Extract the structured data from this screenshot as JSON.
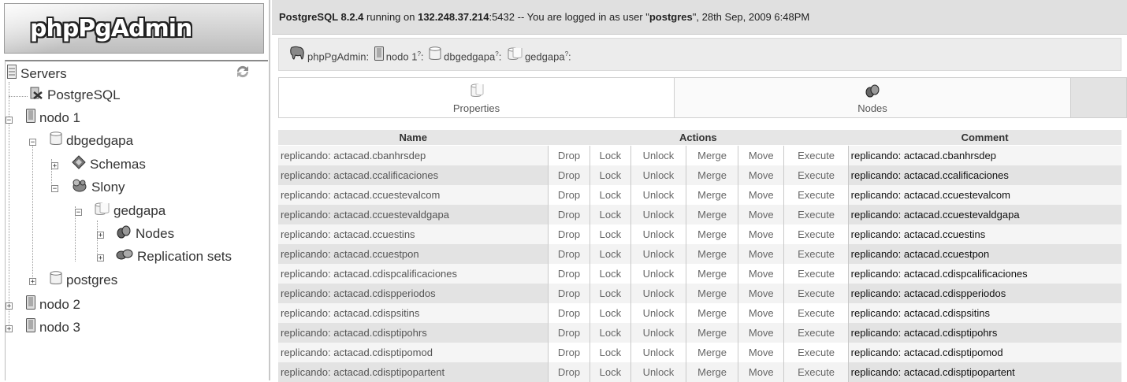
{
  "app": {
    "logo_text": "phpPgAdmin"
  },
  "sidebar": {
    "tree": [
      {
        "label": "Servers",
        "icon": "servers-icon"
      },
      {
        "label": "PostgreSQL",
        "icon": "server-disconnected-icon"
      },
      {
        "label": "nodo 1",
        "icon": "server-icon"
      },
      {
        "label": "dbgedgapa",
        "icon": "database-icon"
      },
      {
        "label": "Schemas",
        "icon": "schemas-icon"
      },
      {
        "label": "Slony",
        "icon": "slony-icon"
      },
      {
        "label": "gedgapa",
        "icon": "cluster-icon"
      },
      {
        "label": "Nodes",
        "icon": "nodes-icon"
      },
      {
        "label": "Replication sets",
        "icon": "replication-sets-icon"
      },
      {
        "label": "postgres",
        "icon": "database-icon"
      },
      {
        "label": "nodo 2",
        "icon": "server-icon"
      },
      {
        "label": "nodo 3",
        "icon": "server-icon"
      }
    ]
  },
  "topbar": {
    "product": "PostgreSQL 8.2.4",
    "running_on": " running on ",
    "host": "132.248.37.214",
    "port": ":5432",
    "logged_text": " -- You are logged in as user \"",
    "user": "postgres",
    "date_text": "\", 28th Sep, 2009 6:48PM"
  },
  "trail": {
    "root": "phpPgAdmin:",
    "server": "nodo 1",
    "database": "dbgedgapa",
    "cluster": "gedgapa",
    "sep": ":",
    "help": "?"
  },
  "tabs": [
    {
      "label": "Properties",
      "icon": "properties-icon"
    },
    {
      "label": "Nodes",
      "icon": "nodes-icon"
    }
  ],
  "table": {
    "headers": {
      "name": "Name",
      "actions": "Actions",
      "comment": "Comment"
    },
    "actions": [
      "Drop",
      "Lock",
      "Unlock",
      "Merge",
      "Move",
      "Execute"
    ],
    "rows": [
      {
        "name": "replicando: actacad.cbanhrsdep",
        "comment": "replicando: actacad.cbanhrsdep"
      },
      {
        "name": "replicando: actacad.ccalificaciones",
        "comment": "replicando: actacad.ccalificaciones"
      },
      {
        "name": "replicando: actacad.ccuestevalcom",
        "comment": "replicando: actacad.ccuestevalcom"
      },
      {
        "name": "replicando: actacad.ccuestevaldgapa",
        "comment": "replicando: actacad.ccuestevaldgapa"
      },
      {
        "name": "replicando: actacad.ccuestins",
        "comment": "replicando: actacad.ccuestins"
      },
      {
        "name": "replicando: actacad.ccuestpon",
        "comment": "replicando: actacad.ccuestpon"
      },
      {
        "name": "replicando: actacad.cdispcalificaciones",
        "comment": "replicando: actacad.cdispcalificaciones"
      },
      {
        "name": "replicando: actacad.cdispperiodos",
        "comment": "replicando: actacad.cdispperiodos"
      },
      {
        "name": "replicando: actacad.cdispsitins",
        "comment": "replicando: actacad.cdispsitins"
      },
      {
        "name": "replicando: actacad.cdisptipohrs",
        "comment": "replicando: actacad.cdisptipohrs"
      },
      {
        "name": "replicando: actacad.cdisptipomod",
        "comment": "replicando: actacad.cdisptipomod"
      },
      {
        "name": "replicando: actacad.cdisptipopartent",
        "comment": "replicando: actacad.cdisptipopartent"
      }
    ]
  }
}
